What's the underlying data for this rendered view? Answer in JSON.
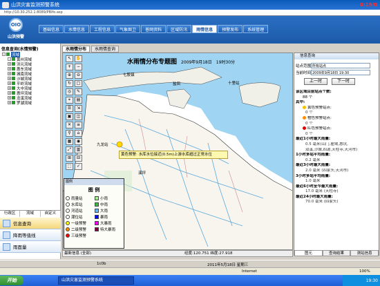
{
  "window": {
    "title": "山洪灾害监测预警系统",
    "clock": "0:19/0"
  },
  "address": {
    "url": "http://10.30.252.1:8089/PBIfo.asp"
  },
  "header": {
    "logo_text": "山洪预警",
    "logo_glyph": "OIO"
  },
  "nav": {
    "items": [
      "基础信息",
      "水情信息",
      "工程信息",
      "气象图卫",
      "普网资料",
      "区域防汛",
      "雨情信息",
      "预警发布",
      "系统管理"
    ],
    "active": 6
  },
  "left": {
    "title": "信息查询(水情预警)",
    "tree": [
      {
        "label": "流域",
        "level": 0,
        "sel": true,
        "box": "-"
      },
      {
        "label": "黄州流域",
        "level": 1,
        "box": "-"
      },
      {
        "label": "洪元流域",
        "level": 1,
        "box": "+"
      },
      {
        "label": "惠东流域",
        "level": 1,
        "box": "+"
      },
      {
        "label": "城南流域",
        "level": 1,
        "box": "+"
      },
      {
        "label": "沙城流域",
        "level": 1,
        "box": "+"
      },
      {
        "label": "平岭流域",
        "level": 1,
        "box": "+"
      },
      {
        "label": "大中流域",
        "level": 1,
        "box": "+"
      },
      {
        "label": "惠坪流域",
        "level": 1,
        "box": "+"
      },
      {
        "label": "龙溪流域",
        "level": 1,
        "box": "+"
      },
      {
        "label": "罗湖流域",
        "level": 1,
        "box": "+"
      }
    ],
    "tabs": [
      "行政区",
      "流域",
      "自定义"
    ],
    "menu": [
      {
        "label": "信息查询",
        "active": true
      },
      {
        "label": "降雨等值线",
        "active": false
      },
      {
        "label": "雨面量",
        "active": false
      }
    ]
  },
  "map": {
    "tabs": [
      "水雨情分布",
      "水雨情查询"
    ],
    "title": "水雨情分布专题图",
    "date": "2009年9月18日",
    "time": "19时30分",
    "popup": "黄色预警: 水库水位接近(0.5m)上游水库超过正常水位",
    "places": [
      "七股镇",
      "盐田",
      "十里站",
      "九龙站",
      "溪坪"
    ],
    "legend": {
      "header": "图例",
      "title": "图 例",
      "items": [
        {
          "label": "雨量站",
          "color": "#ffffff"
        },
        {
          "label": "小雨",
          "color": "#a6f28f"
        },
        {
          "label": "水库站",
          "color": "#ffffff"
        },
        {
          "label": "中雨",
          "color": "#3dba3d"
        },
        {
          "label": "河道站",
          "color": "#ffffff"
        },
        {
          "label": "大雨",
          "color": "#61b8ff"
        },
        {
          "label": "潮位站",
          "color": "#ffffff"
        },
        {
          "label": "暴雨",
          "color": "#0000fe"
        },
        {
          "label": "一级预警",
          "color": "#ffff00"
        },
        {
          "label": "大暴雨",
          "color": "#fa00fa"
        },
        {
          "label": "二级预警",
          "color": "#ff8c00"
        },
        {
          "label": "特大暴雨",
          "color": "#800040"
        },
        {
          "label": "三级预警",
          "color": "#ff0000"
        },
        {
          "label": "",
          "color": ""
        }
      ]
    },
    "status_left": "最新信息 (全部)",
    "status_coords": "经度:120.751  纬度:27.918"
  },
  "right": {
    "header": "信息查询",
    "station_label": "站点范围",
    "station_value": "所有站点",
    "time_label": "当前时间",
    "time_value": "2009年9月18日 19:30",
    "btn_prev": "上一时",
    "btn_next": "下一时",
    "list": [
      {
        "t": "b",
        "text": "该区域目前站点个数:"
      },
      {
        "t": "i",
        "text": "88 个"
      },
      {
        "t": "b",
        "text": "其中:"
      },
      {
        "t": "dot",
        "text": "黄色预警站点:",
        "color": "#f2c200"
      },
      {
        "t": "s",
        "text": "0 个"
      },
      {
        "t": "dot",
        "text": "橙色预警站点:",
        "color": "#ff8c00"
      },
      {
        "t": "s",
        "text": "0 个"
      },
      {
        "t": "dot",
        "text": "红色预警站点:",
        "color": "#e00000"
      },
      {
        "t": "s",
        "text": "0 个"
      },
      {
        "t": "b",
        "text": "最近1小时最大雨量:"
      },
      {
        "t": "s",
        "text": "0.5 毫米(山门,瞿坳,惠坑,"
      },
      {
        "t": "s",
        "text": "双溪,沙城,四源,天柱寺,天河市)"
      },
      {
        "t": "b",
        "text": "1小时多站平均雨量:"
      },
      {
        "t": "s",
        "text": "0.2 毫米"
      },
      {
        "t": "b",
        "text": "最近3小时最大雨量:"
      },
      {
        "t": "s",
        "text": "2.0 毫米 (四家头,天河市)"
      },
      {
        "t": "b",
        "text": "3小时多站平均雨量:"
      },
      {
        "t": "s",
        "text": "1.0 毫米"
      },
      {
        "t": "b",
        "text": "最近6小时至今最大雨量:"
      },
      {
        "t": "s",
        "text": "17.0 毫米 (天柱寺)"
      },
      {
        "t": "b",
        "text": "最近24小时最大雨量:"
      },
      {
        "t": "s",
        "text": "70.0 毫米 (四家头)"
      }
    ],
    "tabs": [
      "图元",
      "查询结果",
      "测站信息"
    ]
  },
  "statusbar": {
    "a": "1c0b",
    "b": "2011年5月18日 星期三"
  },
  "ie": {
    "zone": "Internet",
    "zoom": "100%"
  },
  "taskbar": {
    "start": "开始",
    "app": "山洪灾害监测预警系统",
    "clock": "19:30"
  }
}
